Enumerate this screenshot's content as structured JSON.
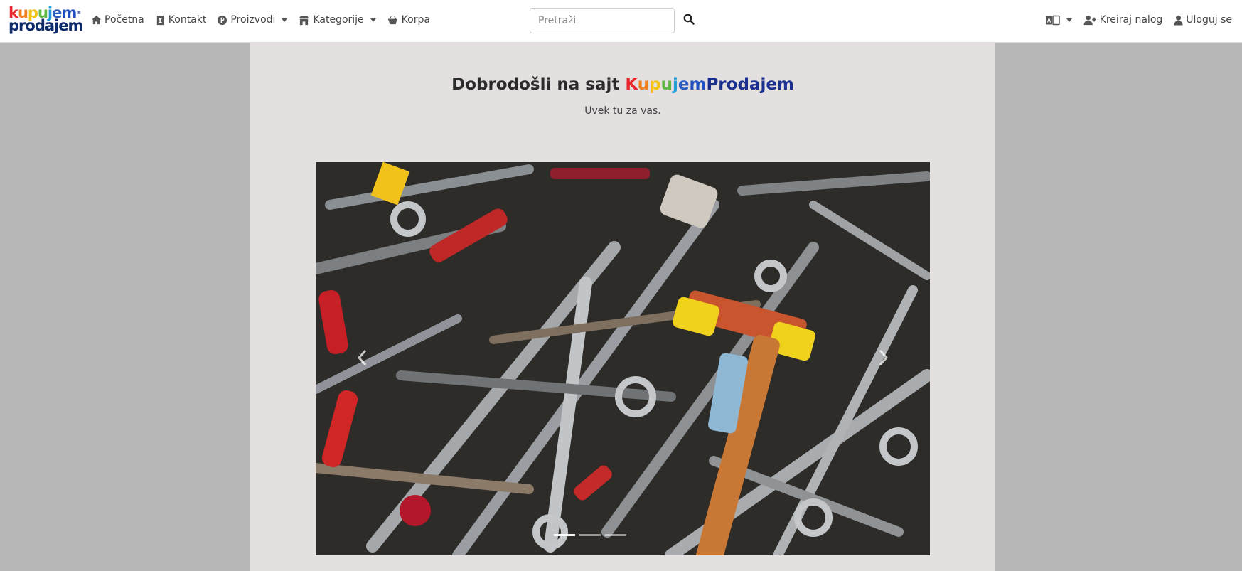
{
  "brand": {
    "logo_top": "kupujem",
    "logo_bottom": "prodajem"
  },
  "nav": {
    "home": "Početna",
    "contact": "Kontakt",
    "products": "Proizvodi",
    "categories": "Kategorije",
    "cart": "Korpa"
  },
  "search": {
    "placeholder": "Pretraži",
    "value": ""
  },
  "nav_right": {
    "language_icon": "language-icon",
    "register": "Kreiraj nalog",
    "login": "Uloguj se"
  },
  "hero": {
    "welcome_prefix": "Dobrodošli na sajt ",
    "brand_letters": [
      "K",
      "u",
      "p",
      "u",
      "j",
      "e",
      "m"
    ],
    "brand_suffix": "Prodajem",
    "tagline": "Uvek tu za vas."
  },
  "carousel": {
    "image_subject": "pile of wrenches and tools",
    "indicator_count": 3,
    "active_indicator": 1
  },
  "colors": {
    "navbar_bg": "#ffffff",
    "page_bg": "#b7b7b7",
    "main_bg": "#e4e0e0",
    "brand_red": "#e8262c",
    "brand_blue": "#1b2f8f"
  }
}
